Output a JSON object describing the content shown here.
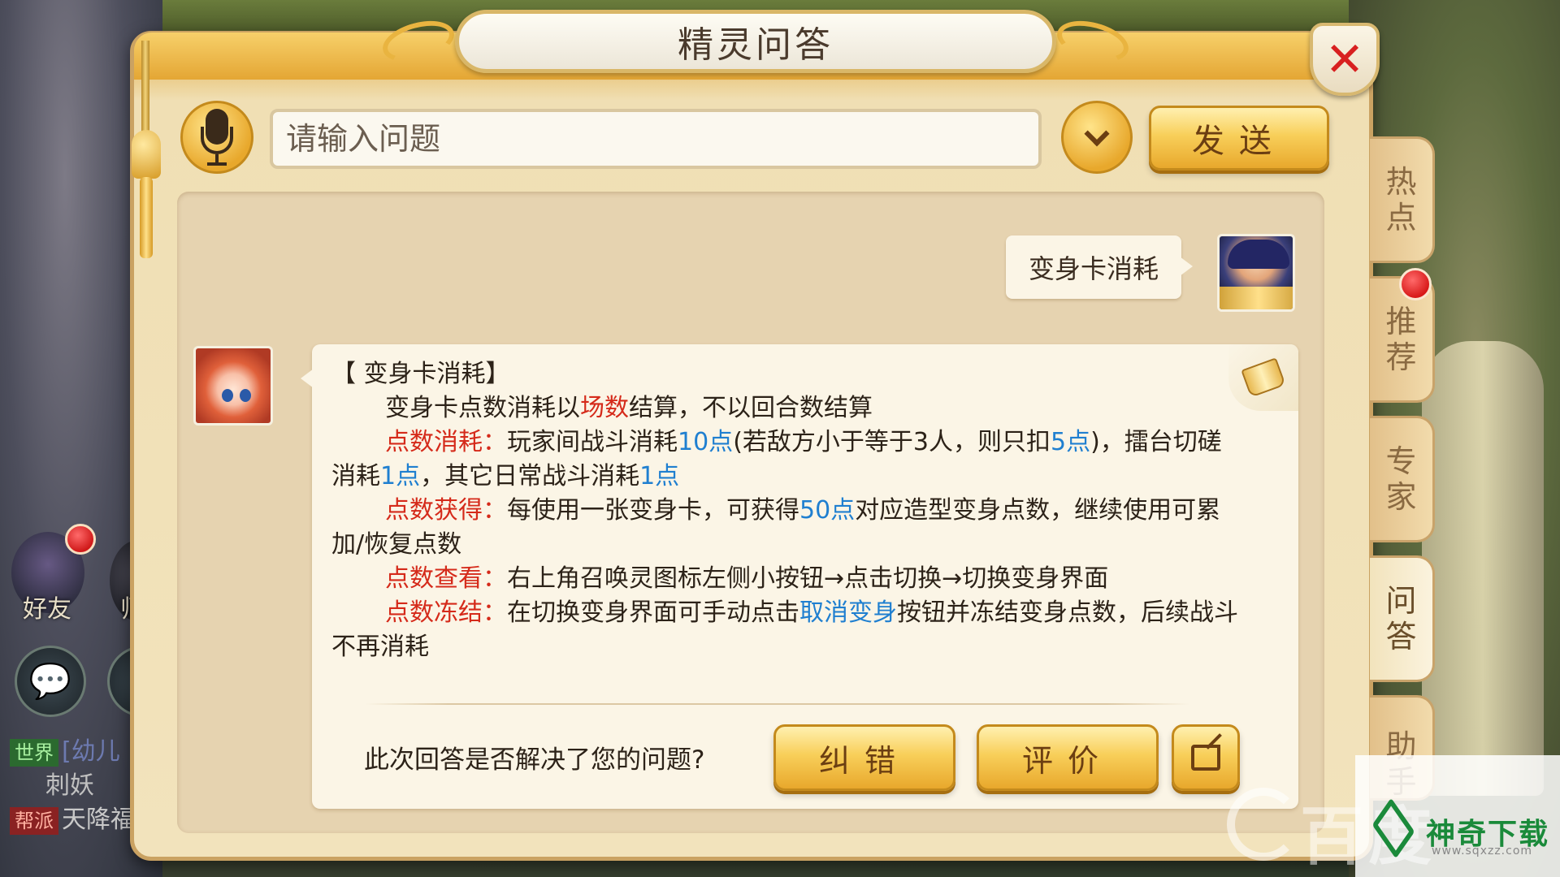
{
  "window": {
    "title": "精灵问答"
  },
  "input": {
    "placeholder": "请输入问题",
    "value": ""
  },
  "toolbar": {
    "send_label": "发送"
  },
  "conversation": {
    "user_question": "变身卡消耗",
    "answer": {
      "heading": "【 变身卡消耗】",
      "intro_pre": "变身卡点数消耗以",
      "intro_hl": "场数",
      "intro_post": "结算，不以回合数结算",
      "items": [
        {
          "label": "点数消耗：",
          "segments": [
            {
              "text": "玩家间战斗消耗",
              "style": "normal"
            },
            {
              "text": "10点",
              "style": "blue"
            },
            {
              "text": "(若敌方小于等于3人，则只扣",
              "style": "normal"
            },
            {
              "text": "5点",
              "style": "blue"
            },
            {
              "text": ")，擂台切磋消耗",
              "style": "normal"
            },
            {
              "text": "1点",
              "style": "blue"
            },
            {
              "text": "，其它日常战斗消耗",
              "style": "normal"
            },
            {
              "text": "1点",
              "style": "blue"
            }
          ]
        },
        {
          "label": "点数获得：",
          "segments": [
            {
              "text": "每使用一张变身卡，可获得",
              "style": "normal"
            },
            {
              "text": "50点",
              "style": "blue"
            },
            {
              "text": "对应造型变身点数，继续使用可累加/恢复点数",
              "style": "normal"
            }
          ]
        },
        {
          "label": "点数查看：",
          "segments": [
            {
              "text": "右上角召唤灵图标左侧小按钮→点击切换→切换变身界面",
              "style": "normal"
            }
          ]
        },
        {
          "label": "点数冻结：",
          "segments": [
            {
              "text": "在切换变身界面可手动点击",
              "style": "normal"
            },
            {
              "text": "取消变身",
              "style": "blue"
            },
            {
              "text": "按钮并冻结变身点数，后续战斗不再消耗",
              "style": "normal"
            }
          ]
        }
      ]
    }
  },
  "feedback": {
    "question": "此次回答是否解决了您的问题?",
    "fix_label": "纠错",
    "rate_label": "评价"
  },
  "side_tabs": [
    {
      "label": "热点",
      "active": false
    },
    {
      "label": "推荐",
      "active": false,
      "has_badge": true
    },
    {
      "label": "专家",
      "active": false
    },
    {
      "label": "问答",
      "active": true
    },
    {
      "label": "助手",
      "active": false
    }
  ],
  "hud": {
    "friend_label": "好友",
    "master_label": "师",
    "chat_lines": [
      {
        "tag": "世界",
        "text": "[幼儿",
        "tag_color": "green"
      },
      {
        "tag": "",
        "text": "刺妖",
        "tag_color": ""
      },
      {
        "tag": "帮派",
        "text": "天降福",
        "tag_color": "red"
      }
    ]
  },
  "watermark": {
    "baidu": "百度",
    "brand": "神奇下载",
    "url": "www.sqxzz.com"
  },
  "colors": {
    "highlight_red": "#d52a1a",
    "highlight_blue": "#1f7fd0",
    "gold_button": "#f8cf5a",
    "close_red": "#d82020"
  },
  "icons": [
    "microphone-icon",
    "chevron-down-icon",
    "close-icon",
    "book-icon",
    "share-icon",
    "chat-bubble-icon"
  ]
}
